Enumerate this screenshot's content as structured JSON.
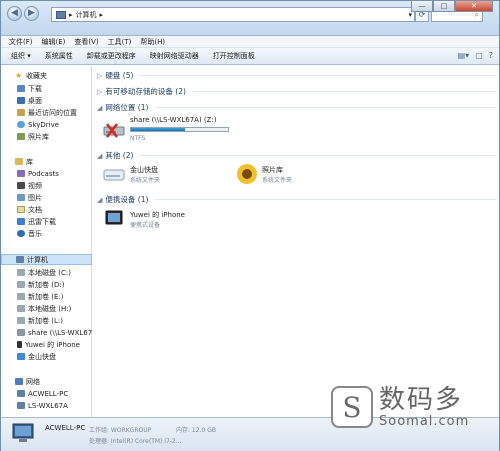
{
  "address": {
    "path": "计算机",
    "arrow": "▸",
    "dropdown": "▾"
  },
  "window_buttons": {
    "minimize": "—",
    "maximize": "□",
    "close": "✕"
  },
  "menu": [
    "文件(F)",
    "编辑(E)",
    "查看(V)",
    "工具(T)",
    "帮助(H)"
  ],
  "toolbar": [
    "组织 ▾",
    "系统属性",
    "卸载或更改程序",
    "映射网络驱动器",
    "打开控制面板"
  ],
  "sidebar": {
    "favorites": {
      "title": "收藏夹",
      "items": [
        "下载",
        "桌面",
        "最近访问的位置",
        "SkyDrive",
        "照片库"
      ]
    },
    "libraries": {
      "title": "库",
      "items": [
        "Podcasts",
        "视频",
        "图片",
        "文档",
        "迅雷下载",
        "音乐"
      ]
    },
    "computer": {
      "title": "计算机",
      "items": [
        "本地磁盘 (C:)",
        "新加卷 (D:)",
        "新加卷 (E:)",
        "本地磁盘 (H:)",
        "新加卷 (L:)",
        "share (\\\\LS-WXL67",
        "Yuwei 的 iPhone",
        "金山快盘"
      ]
    },
    "network": {
      "title": "网络",
      "items": [
        "ACWELL-PC",
        "LS-WXL67A"
      ]
    }
  },
  "groups": {
    "hdd": "硬盘 (5)",
    "removable": "有可移动存储的设备 (2)",
    "network_location": "网络位置 (1)",
    "other": "其他 (2)",
    "portable": "便携设备 (1)"
  },
  "items": {
    "share_name": "share (\\\\LS-WXL67A) (Z:)",
    "share_fs": "NTFS",
    "share_usage": 0.56,
    "kuaipan_name": "金山快盘",
    "kuaipan_desc": "系统文件夹",
    "photo_name": "照片库",
    "photo_desc": "系统文件夹",
    "iphone_name": "Yuwei 的 iPhone",
    "iphone_desc": "便携式设备"
  },
  "status": {
    "computer_name": "ACWELL-PC",
    "workgroup": "工作组: WORKGROUP",
    "memory": "内存: 12.0 GB",
    "cpu": "处理器: Intel(R) Core(TM) i7-2..."
  },
  "watermark": {
    "logo": "S",
    "cn": "数码多",
    "en": "Soomal.com"
  },
  "colors": {
    "accent": "#1f6fb0",
    "header": "#1f3c6b",
    "selected": "#cde4f8"
  }
}
